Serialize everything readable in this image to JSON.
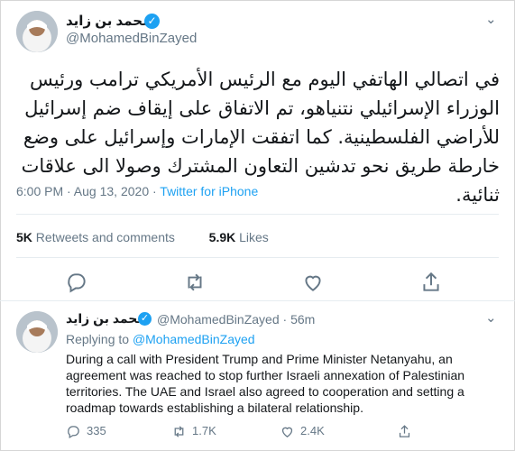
{
  "main_tweet": {
    "display_name": "محمد بن زايد",
    "handle": "@MohamedBinZayed",
    "text": "في اتصالي الهاتفي اليوم مع الرئيس الأمريكي ترامب ورئيس الوزراء الإسرائيلي نتنياهو، تم الاتفاق على إيقاف ضم إسرائيل للأراضي الفلسطينية. كما اتفقت الإمارات وإسرائيل على وضع خارطة طريق نحو تدشين التعاون المشترك وصولا الى علاقات ثنائية.",
    "timestamp": "6:00 PM · Aug 13, 2020 · ",
    "source": "Twitter for iPhone",
    "retweets_count": "5K",
    "retweets_label": "Retweets and comments",
    "likes_count": "5.9K",
    "likes_label": "Likes"
  },
  "reply_tweet": {
    "display_name": "محمد بن زايد",
    "handle": "@MohamedBinZayed",
    "age": "· 56m",
    "replying_label": "Replying to ",
    "replying_mention": "@MohamedBinZayed",
    "text": "During a call with President Trump and Prime Minister Netanyahu, an agreement was reached to stop further Israeli annexation of Palestinian territories. The UAE and Israel also agreed to cooperation and setting a roadmap towards establishing a bilateral relationship.",
    "replies": "335",
    "retweets": "1.7K",
    "likes": "2.4K"
  },
  "colors": {
    "accent": "#1da1f2",
    "muted": "#657786",
    "text": "#14171a",
    "divider": "#e6ecf0"
  },
  "icons": [
    "verified-badge-icon",
    "chevron-down-icon",
    "reply-icon",
    "retweet-icon",
    "like-icon",
    "share-icon"
  ]
}
